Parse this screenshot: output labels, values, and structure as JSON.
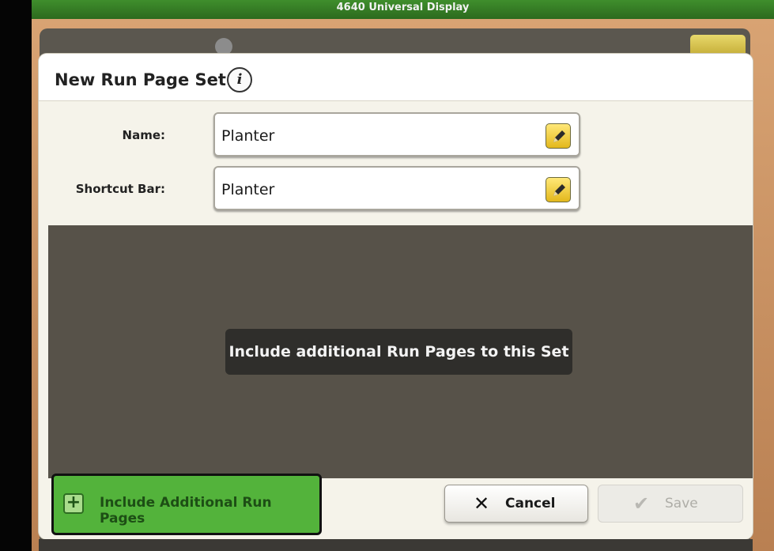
{
  "window": {
    "title": "4640 Universal Display"
  },
  "dialog": {
    "title": "New Run Page Set",
    "info_icon": "info-icon",
    "fields": {
      "name": {
        "label": "Name:",
        "value": "Planter",
        "edit_icon": "pencil-icon"
      },
      "shortcut_bar": {
        "label": "Shortcut Bar:",
        "value": "Planter",
        "edit_icon": "pencil-icon"
      }
    },
    "message": "Include additional Run Pages to this Set",
    "buttons": {
      "include": {
        "label": "Include Additional Run Pages",
        "icon": "plus-icon"
      },
      "cancel": {
        "label": "Cancel",
        "icon": "x-icon"
      },
      "save": {
        "label": "Save",
        "icon": "check-icon",
        "enabled": false
      }
    }
  },
  "colors": {
    "titlebar_green": "#3f8e2c",
    "include_green": "#53b33b",
    "pencil_yellow": "#f0c93a",
    "content_gray": "#575249"
  }
}
